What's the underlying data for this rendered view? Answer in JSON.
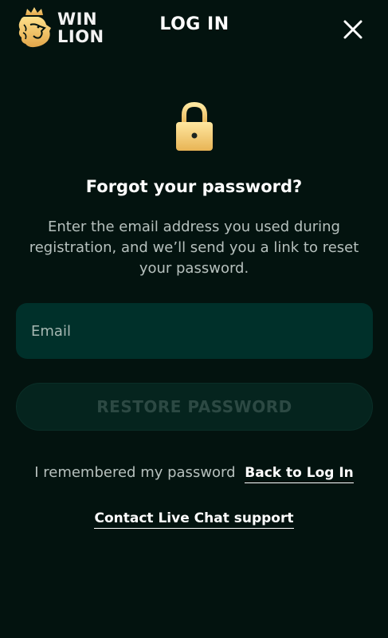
{
  "header": {
    "logo_line1": "WIN",
    "logo_line2": "LION",
    "title": "LOG IN",
    "close_icon": "close-icon"
  },
  "main": {
    "icon": "lock-icon",
    "heading": "Forgot your password?",
    "description": "Enter the email address you used during registration, and we’ll send you a link to reset your password.",
    "email_placeholder": "Email",
    "email_value": "",
    "restore_button": "RESTORE PASSWORD",
    "remember_text": "I remembered my password",
    "back_link": "Back to Log In",
    "contact_link": "Contact Live Chat support"
  },
  "colors": {
    "background": "#03130f",
    "accent_gold": "#f0c060",
    "input_bg": "#00302a",
    "button_bg": "#05241e"
  }
}
